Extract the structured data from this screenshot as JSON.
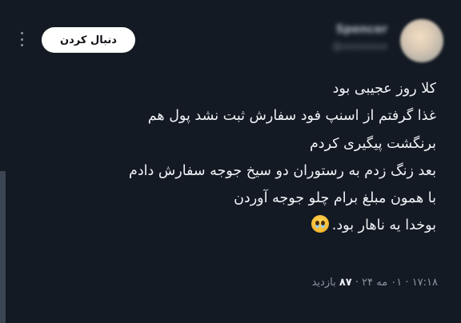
{
  "post": {
    "author_name": "Spencer",
    "author_handle": "xxxxxxxx@",
    "follow_label": "دنبال کردن",
    "text_lines": [
      "کلا روز عجیبی بود",
      "غذا گرفتم از اسنپ فود سفارش ثبت نشد پول هم",
      "برنگشت پیگیری کردم",
      "بعد زنگ زدم به رستوران دو سیخ جوجه سفارش دادم",
      "با همون مبلغ برام چلو جوجه آوردن",
      "بوخدا یه ناهار بود."
    ],
    "emoji_icon": "pleading-face-emoji",
    "meta": {
      "time": "۱۷:۱۸",
      "date": "۰۱ مه ۲۴",
      "views_count": "۸۷",
      "views_label": "بازدید",
      "separator": "·"
    }
  },
  "colors": {
    "background": "#131a23",
    "text": "#f0f3f6",
    "muted": "#8b95a1",
    "follow_bg": "#ffffff"
  }
}
